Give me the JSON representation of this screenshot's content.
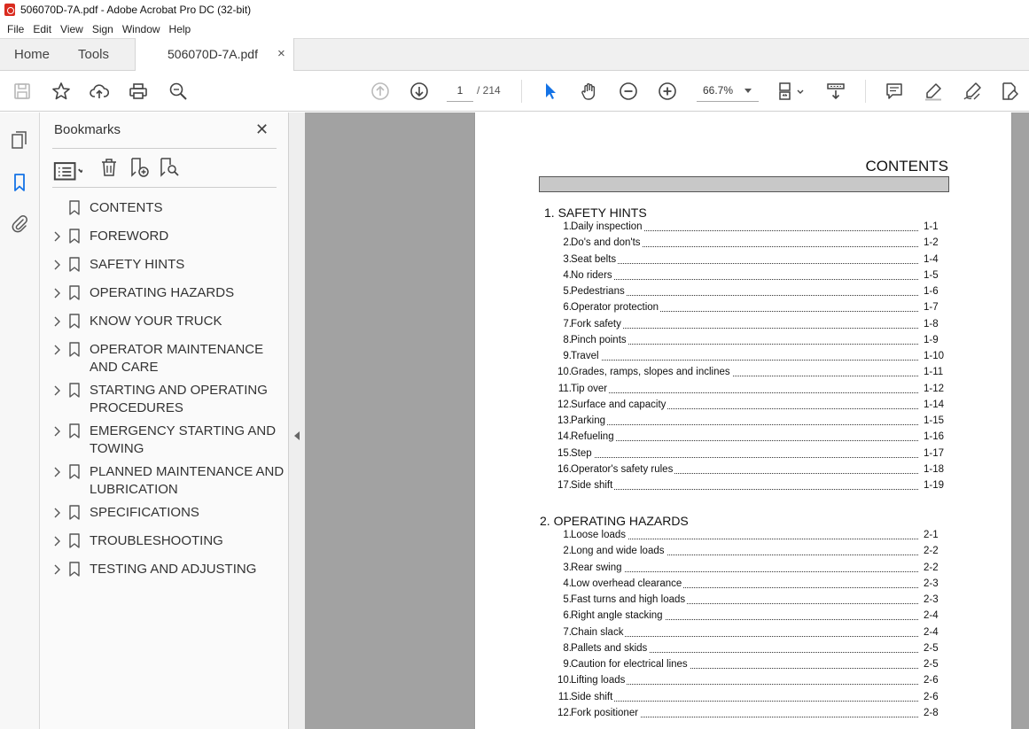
{
  "window": {
    "title": "506070D-7A.pdf - Adobe Acrobat Pro DC (32-bit)"
  },
  "menu": [
    "File",
    "Edit",
    "View",
    "Sign",
    "Window",
    "Help"
  ],
  "tabs": {
    "home": "Home",
    "tools": "Tools",
    "document": "506070D-7A.pdf",
    "close": "×"
  },
  "toolbar": {
    "page_current": "1",
    "page_total": "/  214",
    "zoom": "66.7%"
  },
  "bookmarks": {
    "title": "Bookmarks",
    "close": "✕",
    "items": [
      {
        "label": "CONTENTS",
        "expandable": false
      },
      {
        "label": "FOREWORD",
        "expandable": true
      },
      {
        "label": "SAFETY HINTS",
        "expandable": true
      },
      {
        "label": "OPERATING HAZARDS",
        "expandable": true
      },
      {
        "label": "KNOW YOUR TRUCK",
        "expandable": true
      },
      {
        "label": "OPERATOR MAINTENANCE AND CARE",
        "expandable": true
      },
      {
        "label": "STARTING AND OPERATING PROCEDURES",
        "expandable": true
      },
      {
        "label": "EMERGENCY STARTING AND TOWING",
        "expandable": true
      },
      {
        "label": "PLANNED MAINTENANCE AND LUBRICATION",
        "expandable": true
      },
      {
        "label": "SPECIFICATIONS",
        "expandable": true
      },
      {
        "label": "TROUBLESHOOTING",
        "expandable": true
      },
      {
        "label": "TESTING AND ADJUSTING",
        "expandable": true
      }
    ]
  },
  "document": {
    "title": "CONTENTS",
    "sections": [
      {
        "heading": "1. SAFETY HINTS",
        "entries": [
          {
            "num": "1.",
            "text": "Daily inspection",
            "page": "1-1"
          },
          {
            "num": "2.",
            "text": "Do's and don'ts",
            "page": "1-2"
          },
          {
            "num": "3.",
            "text": "Seat belts",
            "page": "1-4"
          },
          {
            "num": "4.",
            "text": "No riders",
            "page": "1-5"
          },
          {
            "num": "5.",
            "text": "Pedestrians",
            "page": "1-6"
          },
          {
            "num": "6.",
            "text": "Operator protection",
            "page": "1-7"
          },
          {
            "num": "7.",
            "text": "Fork safety",
            "page": "1-8"
          },
          {
            "num": "8.",
            "text": "Pinch points",
            "page": "1-9"
          },
          {
            "num": "9.",
            "text": "Travel",
            "page": "1-10"
          },
          {
            "num": "10.",
            "text": "Grades, ramps, slopes and inclines",
            "page": "1-11"
          },
          {
            "num": "11.",
            "text": "Tip over",
            "page": "1-12"
          },
          {
            "num": "12.",
            "text": "Surface and capacity",
            "page": "1-14"
          },
          {
            "num": "13.",
            "text": "Parking",
            "page": "1-15"
          },
          {
            "num": "14.",
            "text": "Refueling",
            "page": "1-16"
          },
          {
            "num": "15.",
            "text": "Step",
            "page": "1-17"
          },
          {
            "num": "16.",
            "text": "Operator's safety rules",
            "page": "1-18"
          },
          {
            "num": "17.",
            "text": "Side shift",
            "page": "1-19"
          }
        ]
      },
      {
        "heading": "2. OPERATING HAZARDS",
        "entries": [
          {
            "num": "1.",
            "text": "Loose loads",
            "page": "2-1"
          },
          {
            "num": "2.",
            "text": "Long and wide loads",
            "page": "2-2"
          },
          {
            "num": "3.",
            "text": "Rear swing",
            "page": "2-2"
          },
          {
            "num": "4.",
            "text": "Low overhead clearance",
            "page": "2-3"
          },
          {
            "num": "5.",
            "text": "Fast turns and high loads",
            "page": "2-3"
          },
          {
            "num": "6.",
            "text": "Right angle stacking",
            "page": "2-4"
          },
          {
            "num": "7.",
            "text": "Chain slack",
            "page": "2-4"
          },
          {
            "num": "8.",
            "text": "Pallets and skids",
            "page": "2-5"
          },
          {
            "num": "9.",
            "text": "Caution for electrical lines",
            "page": "2-5"
          },
          {
            "num": "10.",
            "text": "Lifting loads",
            "page": "2-6"
          },
          {
            "num": "11.",
            "text": "Side shift",
            "page": "2-6"
          },
          {
            "num": "12.",
            "text": "Fork positioner",
            "page": "2-8"
          }
        ]
      }
    ]
  },
  "colors": {
    "accent": "#1473e6",
    "doc_background": "#a2a2a2"
  }
}
